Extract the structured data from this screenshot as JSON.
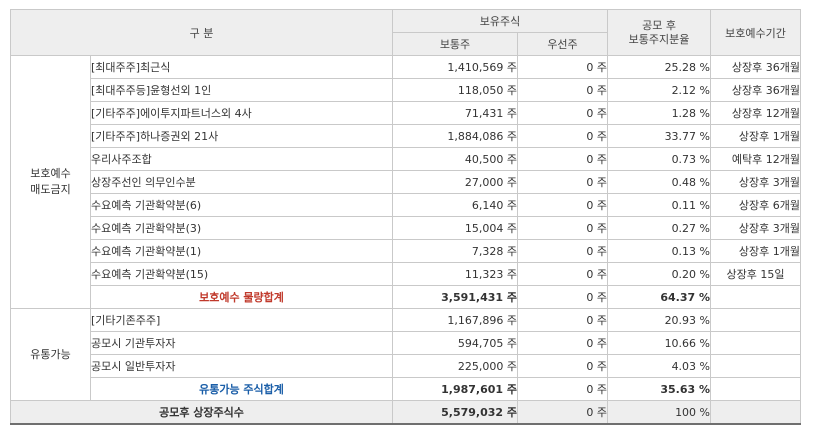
{
  "header": {
    "category": "구    분",
    "holding": "보유주식",
    "common": "보통주",
    "preferred": "우선주",
    "ratio_line1": "공모 후",
    "ratio_line2": "보통주지분율",
    "period": "보호예수기간"
  },
  "groups": {
    "lockup": "보호예수\n매도금지",
    "tradable": "유통가능"
  },
  "lockup_rows": [
    {
      "label": "[최대주주]최근식",
      "common": "1,410,569 주",
      "preferred": "0 주",
      "ratio": "25.28 %",
      "period": "상장후 36개월"
    },
    {
      "label": "[최대주주등]윤형선외 1인",
      "common": "118,050 주",
      "preferred": "0 주",
      "ratio": "2.12 %",
      "period": "상장후 36개월"
    },
    {
      "label": "[기타주주]에이투지파트너스외 4사",
      "common": "71,431 주",
      "preferred": "0 주",
      "ratio": "1.28 %",
      "period": "상장후 12개월"
    },
    {
      "label": "[기타주주]하나증권외 21사",
      "common": "1,884,086 주",
      "preferred": "0 주",
      "ratio": "33.77 %",
      "period": "상장후 1개월"
    },
    {
      "label": "우리사주조합",
      "common": "40,500 주",
      "preferred": "0 주",
      "ratio": "0.73 %",
      "period": "예탁후 12개월"
    },
    {
      "label": "상장주선인 의무인수분",
      "common": "27,000 주",
      "preferred": "0 주",
      "ratio": "0.48 %",
      "period": "상장후 3개월"
    },
    {
      "label": "수요예측 기관확약분(6)",
      "common": "6,140 주",
      "preferred": "0 주",
      "ratio": "0.11 %",
      "period": "상장후 6개월"
    },
    {
      "label": "수요예측 기관확약분(3)",
      "common": "15,004 주",
      "preferred": "0 주",
      "ratio": "0.27 %",
      "period": "상장후 3개월"
    },
    {
      "label": "수요예측 기관확약분(1)",
      "common": "7,328 주",
      "preferred": "0 주",
      "ratio": "0.13 %",
      "period": "상장후 1개월"
    },
    {
      "label": "수요예측 기관확약분(15)",
      "common": "11,323 주",
      "preferred": "0 주",
      "ratio": "0.20 %",
      "period": "상장후 15일"
    }
  ],
  "lockup_total": {
    "label": "보호예수 물량합계",
    "common": "3,591,431 주",
    "preferred": "0 주",
    "ratio": "64.37 %",
    "period": ""
  },
  "tradable_rows": [
    {
      "label": "[기타기존주주]",
      "common": "1,167,896 주",
      "preferred": "0 주",
      "ratio": "20.93 %",
      "period": ""
    },
    {
      "label": "공모시 기관투자자",
      "common": "594,705 주",
      "preferred": "0 주",
      "ratio": "10.66 %",
      "period": ""
    },
    {
      "label": "공모시 일반투자자",
      "common": "225,000 주",
      "preferred": "0 주",
      "ratio": "4.03 %",
      "period": ""
    }
  ],
  "tradable_total": {
    "label": "유통가능 주식합계",
    "common": "1,987,601 주",
    "preferred": "0 주",
    "ratio": "35.63 %",
    "period": ""
  },
  "grand_total": {
    "label": "공모후 상장주식수",
    "common": "5,579,032 주",
    "preferred": "0 주",
    "ratio": "100 %",
    "period": ""
  }
}
